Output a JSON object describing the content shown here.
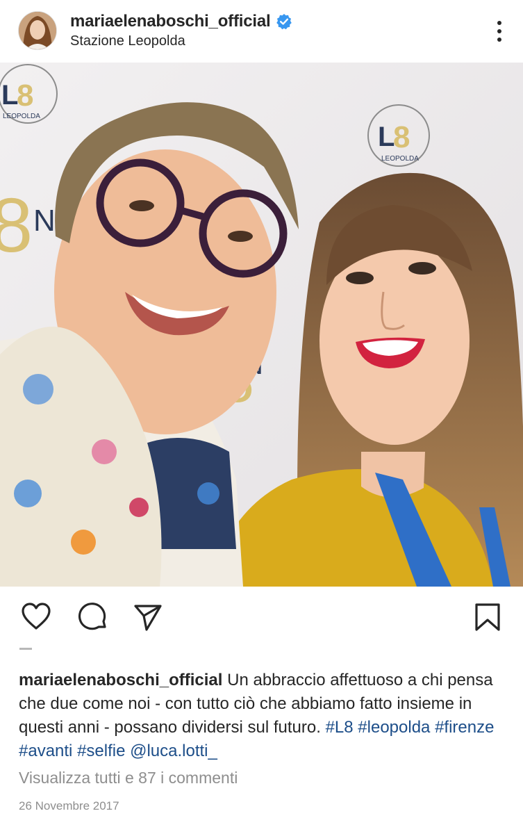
{
  "post": {
    "username": "mariaelenaboschi_official",
    "location": "Stazione Leopolda",
    "verified": true,
    "photo": {
      "backdrop_logo_text": "LEOPOLDA",
      "backdrop_logo_mark": "L8",
      "backdrop_letter": "N"
    },
    "caption": {
      "username": "mariaelenaboschi_official",
      "text": "Un abbraccio affettuoso a chi pensa che due come noi - con tutto ciò che abbiamo fatto insieme in questi anni - possano dividersi sul futuro.",
      "hashtags": [
        "#L8",
        "#leopolda",
        "#firenze",
        "#avanti",
        "#selfie"
      ],
      "mention": "@luca.lotti_"
    },
    "view_comments": "Visualizza tutti e 87 i commenti",
    "date": "26 Novembre 2017"
  },
  "icons": {
    "like": "heart-icon",
    "comment": "comment-icon",
    "share": "send-icon",
    "save": "bookmark-icon",
    "more": "more-vertical-icon",
    "verified": "verified-badge-icon"
  },
  "colors": {
    "verified": "#3897f0",
    "hashtag": "#1d4e89",
    "muted": "#8e8e8e",
    "logo_gold": "#d9c074",
    "logo_navy": "#2b3a5a"
  }
}
